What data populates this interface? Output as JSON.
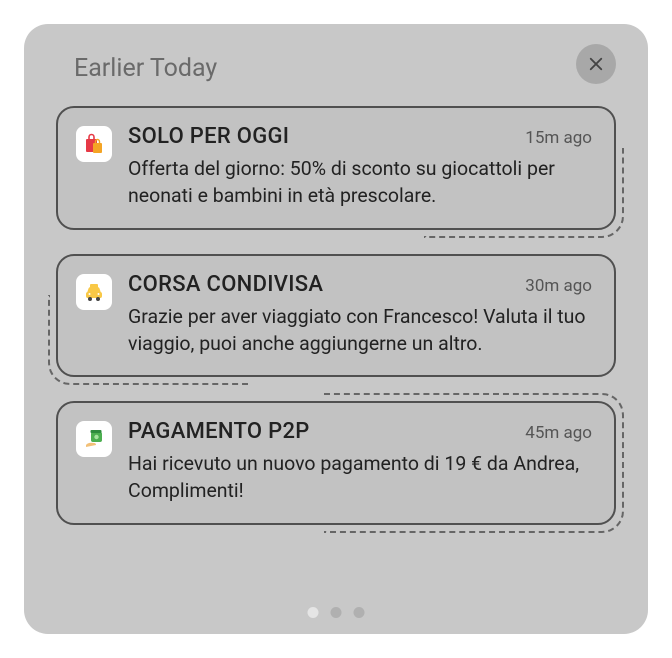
{
  "header": {
    "title": "Earlier Today"
  },
  "notifications": [
    {
      "icon": "shopping-bag-icon",
      "title": "SOLO PER OGGI",
      "time": "15m ago",
      "message": "Offerta del giorno: 50% di sconto su giocattoli per neonati e bambini in età prescolare."
    },
    {
      "icon": "taxi-icon",
      "title": "CORSA CONDIVISA",
      "time": "30m ago",
      "message": "Grazie per aver viaggiato con Francesco! Valuta il tuo viaggio, puoi anche aggiungerne un altro."
    },
    {
      "icon": "payment-icon",
      "title": "PAGAMENTO P2P",
      "time": "45m ago",
      "message": "Hai ricevuto un nuovo pagamento di 19 € da Andrea, Complimenti!"
    }
  ]
}
